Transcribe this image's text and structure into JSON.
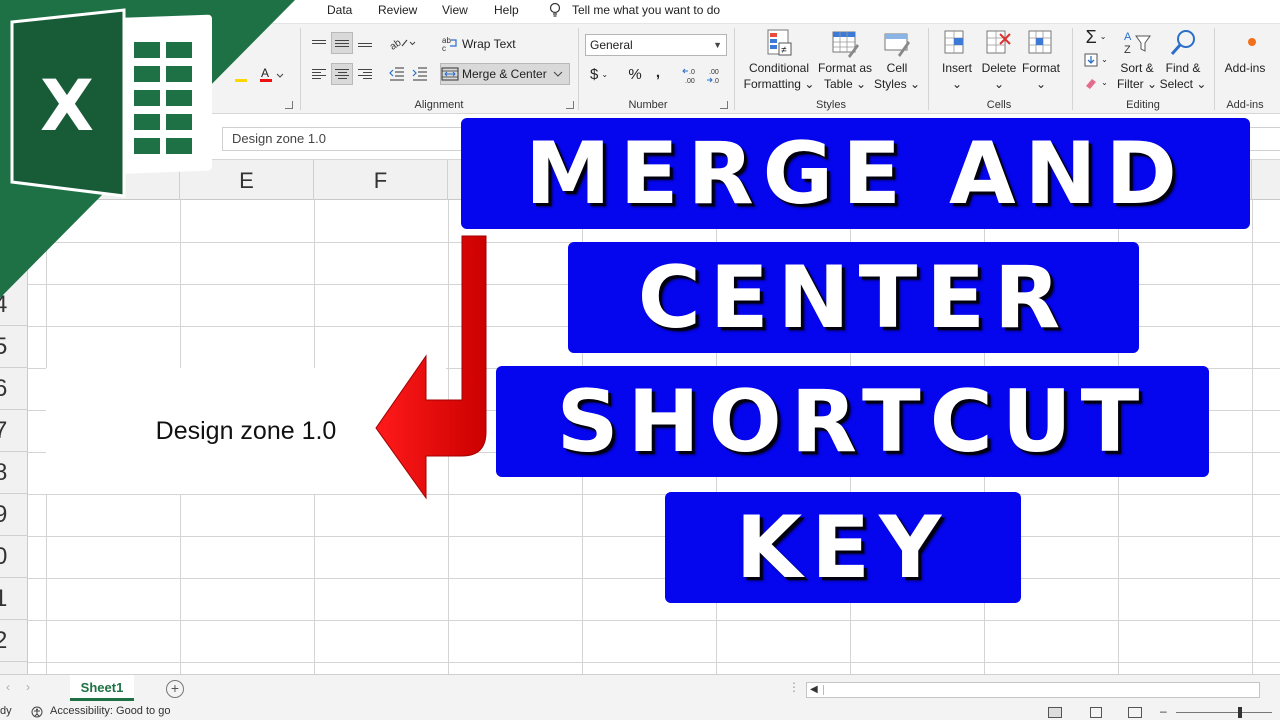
{
  "menu": {
    "items": [
      "Data",
      "Review",
      "View",
      "Help"
    ],
    "tell_me": "Tell me what you want to do"
  },
  "ribbon": {
    "alignment": {
      "wrap_text": "Wrap Text",
      "merge_center": "Merge & Center",
      "group_label": "Alignment"
    },
    "number": {
      "format_value": "General",
      "currency": "$",
      "percent": "%",
      "comma": ",",
      "increase_decimal": "←.0\n.00",
      "decrease_decimal": ".00\n→.0",
      "group_label": "Number"
    },
    "styles": {
      "conditional_line1": "Conditional",
      "conditional_line2": "Formatting",
      "format_table_line1": "Format as",
      "format_table_line2": "Table",
      "cell_styles_line1": "Cell",
      "cell_styles_line2": "Styles",
      "group_label": "Styles"
    },
    "cells": {
      "insert": "Insert",
      "delete": "Delete",
      "format": "Format",
      "group_label": "Cells"
    },
    "editing": {
      "sort_line1": "Sort &",
      "sort_line2": "Filter",
      "find_line1": "Find &",
      "find_line2": "Select",
      "group_label": "Editing"
    },
    "addins": {
      "button": "Add-ins",
      "group_label": "Add-ins"
    }
  },
  "formula_bar": {
    "content": "Design zone 1.0"
  },
  "grid": {
    "columns": [
      "E",
      "F"
    ],
    "rows": [
      "4",
      "5",
      "6",
      "7",
      "8",
      "9",
      "0",
      "1",
      "2"
    ],
    "merged_cell_text": "Design zone 1.0"
  },
  "sheets": {
    "tabs": [
      "Sheet1"
    ],
    "add_symbol": "+"
  },
  "status": {
    "mode": "dy",
    "accessibility": "Accessibility: Good to go"
  },
  "overlay": {
    "title_lines": [
      "MERGE AND",
      "CENTER",
      "SHORTCUT",
      "KEY"
    ],
    "logo_letter": "X",
    "colors": {
      "title_box": "#0505ee",
      "arrow": "#ee1111",
      "excel_green": "#1e7145"
    }
  }
}
